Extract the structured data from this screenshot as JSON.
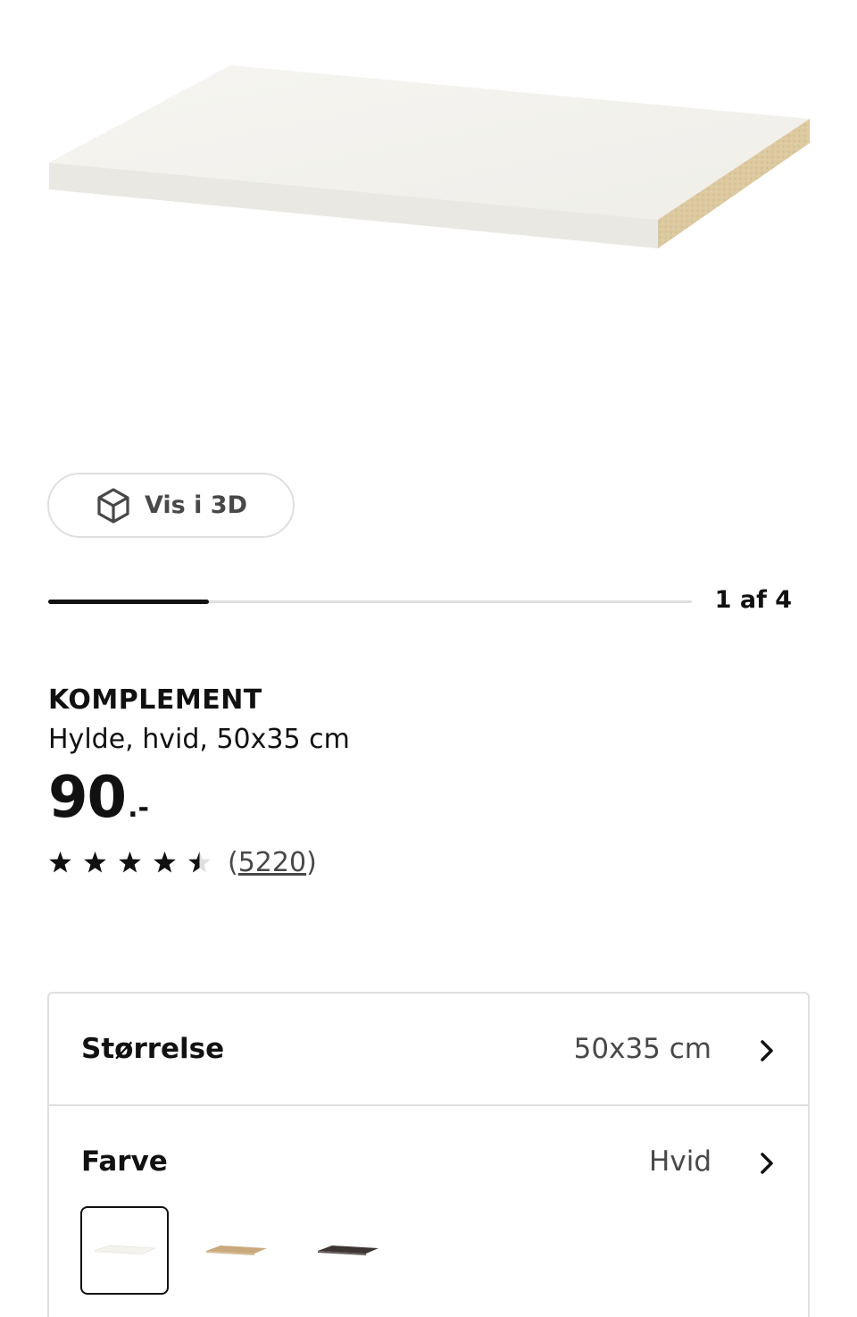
{
  "gallery": {
    "image_alt": "KOMPLEMENT hylde",
    "view_3d_label": "Vis i 3D",
    "view_3d_icon": "cube-icon",
    "counter": "1 af 4",
    "progress": 0.25
  },
  "product": {
    "name": "KOMPLEMENT",
    "description": "Hylde, hvid, 50x35 cm",
    "price": "90",
    "price_suffix": ".-",
    "rating_value": 4.5,
    "rating_max": 5,
    "review_count_open": "(",
    "review_count": "5220",
    "review_count_close": ")"
  },
  "options": {
    "size": {
      "label": "Størrelse",
      "value": "50x35 cm",
      "icon": "chevron-right-icon"
    },
    "color": {
      "label": "Farve",
      "value": "Hvid",
      "icon": "chevron-right-icon",
      "swatches": [
        {
          "name": "Hvid",
          "color": "#f4f3ee",
          "selected": true
        },
        {
          "name": "Lys eg",
          "color": "#c9a97b",
          "selected": false
        },
        {
          "name": "Mørk brun",
          "color": "#3d3533",
          "selected": false
        }
      ]
    }
  },
  "colors": {
    "text": "#111111",
    "muted": "#484848",
    "border": "#dfdfdf",
    "shelf_top": "#f4f3ee",
    "shelf_edge": "#dcc9a0"
  }
}
